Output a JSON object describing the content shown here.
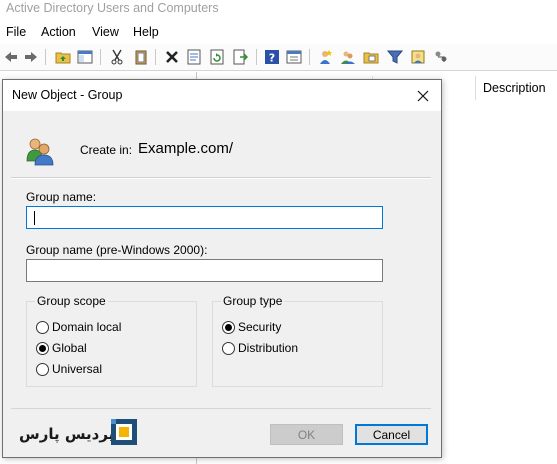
{
  "app": {
    "title": "Active Directory Users and Computers",
    "menu": [
      "File",
      "Action",
      "View",
      "Help"
    ],
    "toolbar_icons": [
      "back-arrow-icon",
      "forward-arrow-icon",
      "folder-up-icon",
      "show-console-tree-icon",
      "cut-icon",
      "paste-icon",
      "delete-icon",
      "properties-icon",
      "refresh-icon",
      "export-list-icon",
      "help-icon",
      "filter-options-icon",
      "new-user-icon",
      "new-group-icon",
      "new-ou-icon",
      "filter-icon",
      "add-to-group-icon",
      "delegate-icon"
    ],
    "column_header": "Description"
  },
  "dialog": {
    "title": "New Object - Group",
    "create_in_label": "Create in:",
    "create_in_path": "Example.com/",
    "group_name_label": "Group name:",
    "group_name_value": "",
    "group_name_prewin_label": "Group name (pre-Windows 2000):",
    "group_name_prewin_value": "",
    "group_scope": {
      "title": "Group scope",
      "options": [
        "Domain local",
        "Global",
        "Universal"
      ],
      "selected": "Global"
    },
    "group_type": {
      "title": "Group type",
      "options": [
        "Security",
        "Distribution"
      ],
      "selected": "Security"
    },
    "ok_label": "OK",
    "cancel_label": "Cancel",
    "close_glyph": "✕"
  },
  "watermark": {
    "text": "پردیس پارس"
  },
  "colors": {
    "accent": "#0078d7",
    "dialog_bg": "#f0f0f0",
    "disabled_text": "#838383"
  }
}
